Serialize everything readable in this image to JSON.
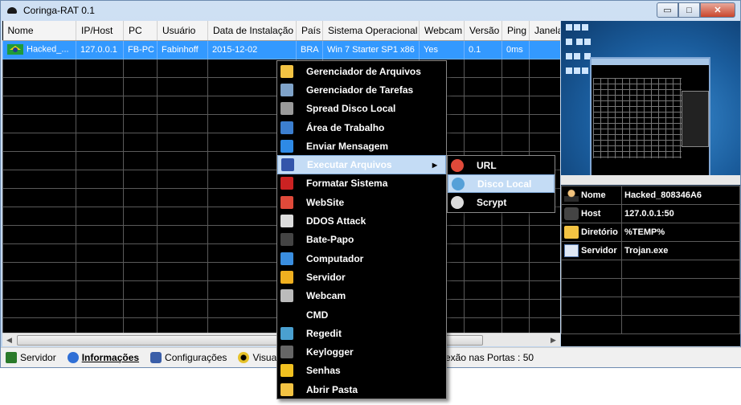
{
  "window": {
    "title": "Coringa-RAT 0.1",
    "controls": {
      "minimize": "▭",
      "maximize": "□",
      "close": "✕"
    }
  },
  "grid": {
    "columns": [
      "Nome",
      "IP/Host",
      "PC",
      "Usuário",
      "Data de Instalação",
      "País",
      "Sistema Operacional",
      "Webcam",
      "Versão",
      "Ping",
      "Janelas"
    ],
    "rows": [
      {
        "nome": "Hacked_...",
        "ip": "127.0.0.1",
        "pc": "FB-PC",
        "usuario": "Fabinhoff",
        "data": "2015-12-02",
        "pais": "BRA",
        "so": "Win 7 Starter SP1 x86",
        "webcam": "Yes",
        "versao": "0.1",
        "ping": "0ms",
        "janelas": ""
      }
    ]
  },
  "info_panel": {
    "rows": [
      {
        "icon": "user-icon",
        "label": "Nome",
        "value": "Hacked_808346A6"
      },
      {
        "icon": "host-icon",
        "label": "Host",
        "value": "127.0.0.1:50"
      },
      {
        "icon": "folder-icon",
        "label": "Diretório",
        "value": "%TEMP%"
      },
      {
        "icon": "exe-icon",
        "label": "Servidor",
        "value": "Trojan.exe"
      }
    ]
  },
  "context_menu": {
    "items": [
      {
        "label": "Gerenciador de Arquivos",
        "icon": "folder-icon",
        "color": "#f3c343"
      },
      {
        "label": "Gerenciador de Tarefas",
        "icon": "task-manager-icon",
        "color": "#7fa3c9"
      },
      {
        "label": "Spread Disco Local",
        "icon": "disk-icon",
        "color": "#9a9a9a"
      },
      {
        "label": "Área de Trabalho",
        "icon": "desktop-icon",
        "color": "#3c7fd0"
      },
      {
        "label": "Enviar Mensagem",
        "icon": "message-icon",
        "color": "#2e8ae6"
      },
      {
        "label": "Executar Arquivos",
        "icon": "execute-icon",
        "color": "#3355aa",
        "highlighted": true,
        "submenu": true
      },
      {
        "label": "Formatar Sistema",
        "icon": "virus-icon",
        "color": "#cc2222"
      },
      {
        "label": "WebSite",
        "icon": "chrome-icon",
        "color": "#e04a3a"
      },
      {
        "label": "DDOS Attack",
        "icon": "anonymous-mask-icon",
        "color": "#dddddd"
      },
      {
        "label": "Bate-Papo",
        "icon": "chat-icon",
        "color": "#444444"
      },
      {
        "label": "Computador",
        "icon": "computer-icon",
        "color": "#3a8ee0"
      },
      {
        "label": "Servidor",
        "icon": "warning-icon",
        "color": "#f0b020"
      },
      {
        "label": "Webcam",
        "icon": "webcam-icon",
        "color": "#bbbbbb"
      },
      {
        "label": "CMD",
        "icon": "cmd-icon",
        "color": "#000000"
      },
      {
        "label": "Regedit",
        "icon": "regedit-icon",
        "color": "#4aa0d0"
      },
      {
        "label": "Keylogger",
        "icon": "keylogger-icon",
        "color": "#666666"
      },
      {
        "label": "Senhas",
        "icon": "lock-icon",
        "color": "#f0c020"
      },
      {
        "label": "Abrir Pasta",
        "icon": "folder-icon",
        "color": "#f3c343"
      }
    ]
  },
  "submenu": {
    "items": [
      {
        "label": "URL",
        "icon": "chrome-icon",
        "color": "#e04a3a"
      },
      {
        "label": "Disco Local",
        "icon": "install-icon",
        "color": "#55a0d8",
        "highlighted": true
      },
      {
        "label": "Scrypt",
        "icon": "script-icon",
        "color": "#dddddd"
      }
    ]
  },
  "statusbar": {
    "servidor": "Servidor",
    "informacoes": "Informações",
    "configuracoes": "Configurações",
    "visualizar": "Visuali",
    "ports": "exão nas Portas : 50"
  }
}
